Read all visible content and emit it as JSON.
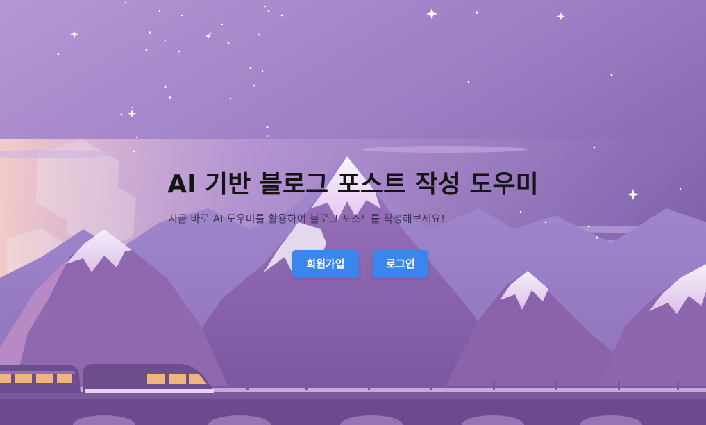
{
  "hero": {
    "title": "AI 기반 블로그 포스트 작성 도우미",
    "subtitle": "지금 바로 AI 도우미를 활용하여 블로그 포스트를 작성해보세요!"
  },
  "actions": {
    "signup_label": "회원가입",
    "login_label": "로그인"
  },
  "theme": {
    "button_color": "#3b86ee",
    "sky_top": "#9b86c8",
    "sky_right": "#6e4f98",
    "mountain_color": "#8a62a8",
    "train_color": "#6c4d8d",
    "train_window_color": "#f1b47a"
  },
  "background": {
    "scene": "purple-mountain-night-sky",
    "decorations": [
      "star-icon",
      "train",
      "bridge",
      "mountains"
    ]
  }
}
